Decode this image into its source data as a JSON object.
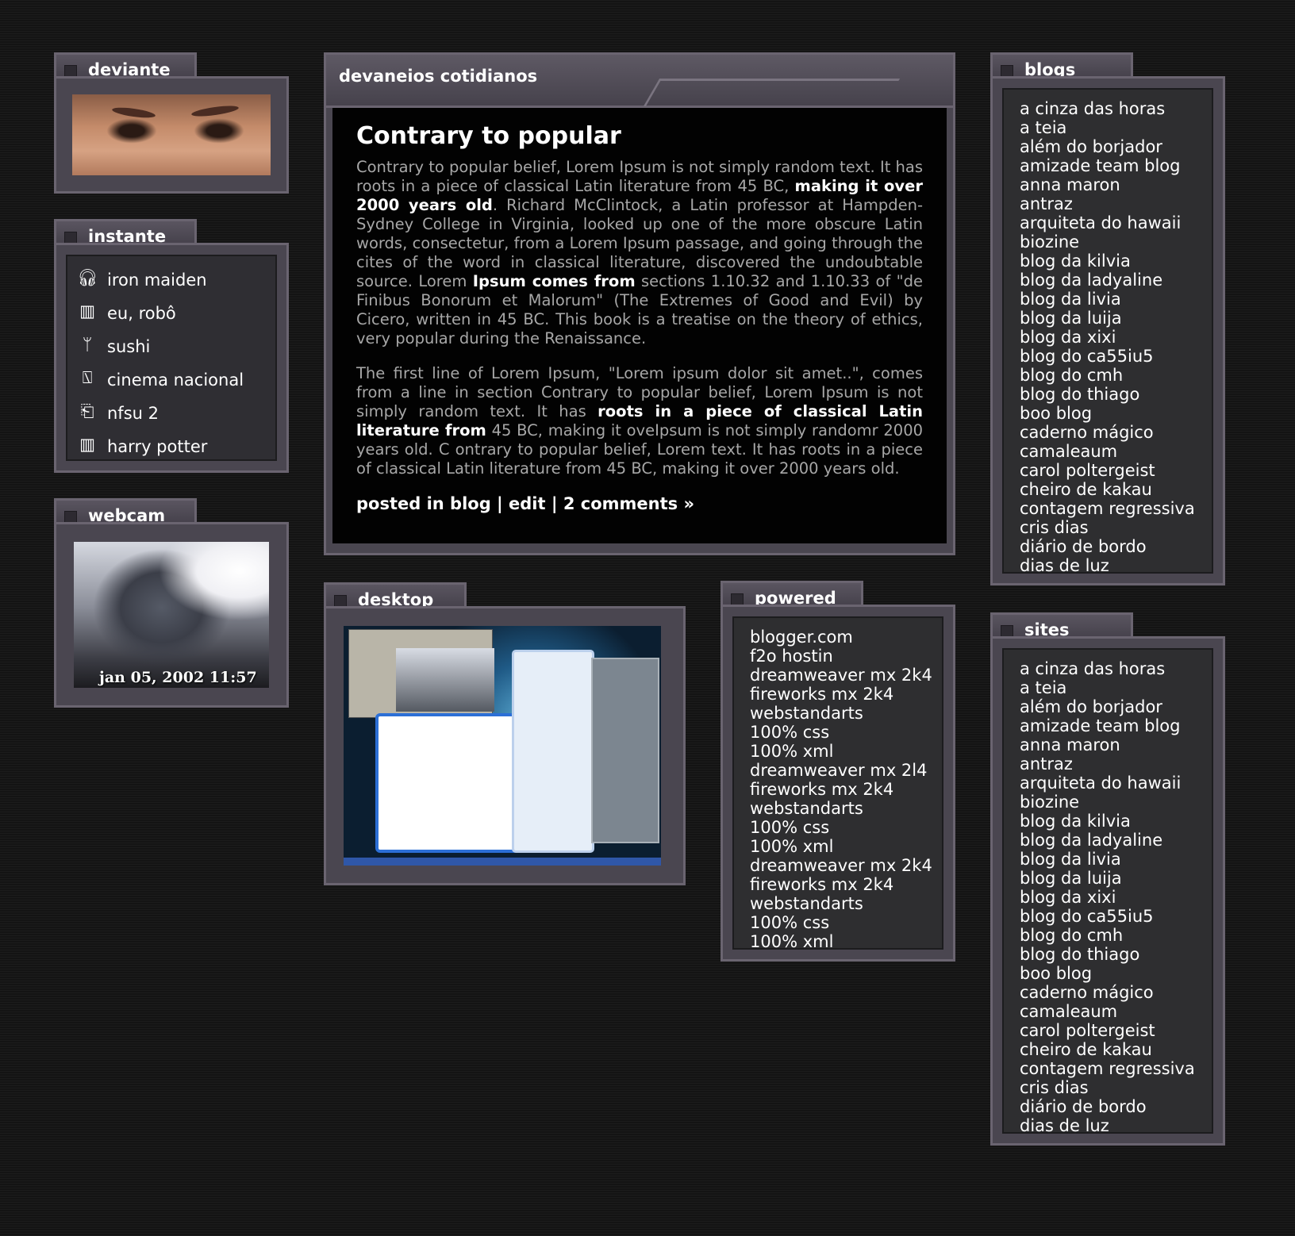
{
  "deviante": {
    "title": "deviante"
  },
  "instante": {
    "title": "instante",
    "items": [
      {
        "icon": "headphones-icon",
        "label": "iron maiden"
      },
      {
        "icon": "film-icon",
        "label": "eu, robô"
      },
      {
        "icon": "utensils-icon",
        "label": "sushi"
      },
      {
        "icon": "tv-icon",
        "label": "cinema nacional"
      },
      {
        "icon": "gamepad-icon",
        "label": "nfsu 2"
      },
      {
        "icon": "book-icon",
        "label": "harry potter"
      }
    ]
  },
  "webcam": {
    "title": "webcam",
    "timestamp": "jan 05, 2002 11:57"
  },
  "post": {
    "header": "devaneios cotidianos",
    "title": "Contrary to popular",
    "p1": {
      "a": "Contrary to popular belief, Lorem Ipsum is not simply random text. It has roots in a piece of classical Latin literature from 45 BC, ",
      "b": "making it over 2000 years old",
      "c": ". Richard McClintock, a Latin professor at Hampden-Sydney College in Virginia, looked up one of the more obscure Latin words, consectetur, from a Lorem Ipsum passage, and going through the cites of the word in classical literature, discovered the undoubtable source. Lorem ",
      "d": "Ipsum comes from",
      "e": " sections 1.10.32 and 1.10.33 of \"de Finibus Bonorum et Malorum\" (The Extremes of Good and Evil) by Cicero, written in 45 BC. This book is a treatise on the theory of ethics, very popular during the Renaissance."
    },
    "p2": {
      "a": "The first line of Lorem Ipsum, \"Lorem ipsum dolor sit amet..\", comes from a line in section Contrary to popular belief, Lorem Ipsum is not simply random text. It has ",
      "b": "roots in a piece of classical Latin literature from",
      "c": " 45 BC, making it oveIpsum is not simply randomr 2000 years old. C ontrary to popular belief, Lorem text. It has roots in a piece of classical Latin literature from 45 BC, making it over 2000 years old."
    },
    "meta": {
      "posted": "posted in blog",
      "sep1": " | ",
      "edit": "edit",
      "sep2": " | ",
      "comments": "2 comments »"
    }
  },
  "desktop": {
    "title": "desktop"
  },
  "powered": {
    "title": "powered",
    "items": [
      "blogger.com",
      "f2o hostin",
      "dreamweaver mx 2k4",
      "fireworks mx 2k4",
      "webstandarts",
      "100% css",
      "100% xml",
      "dreamweaver mx 2l4",
      "fireworks mx 2k4",
      "webstandarts",
      "100% css",
      "100% xml",
      "dreamweaver mx 2k4",
      "fireworks mx 2k4",
      "webstandarts",
      "100% css",
      "100% xml"
    ]
  },
  "blogs": {
    "title": "blogs",
    "items": [
      "a cinza das horas",
      "a teia",
      "além do borjador",
      "amizade team blog",
      "anna maron",
      "antraz",
      "arquiteta do hawaii",
      "biozine",
      "blog da kilvia",
      "blog da ladyaline",
      "blog da livia",
      "blog da luija",
      "blog da xixi",
      "blog do ca55iu5",
      "blog do cmh",
      "blog do thiago",
      "boo blog",
      "caderno mágico",
      "camaleaum",
      "carol poltergeist",
      "cheiro de kakau",
      "contagem regressiva",
      "cris dias",
      "diário de bordo",
      "dias de luz"
    ]
  },
  "sites": {
    "title": "sites",
    "items": [
      "a cinza das horas",
      "a teia",
      "além do borjador",
      "amizade team blog",
      "anna maron",
      "antraz",
      "arquiteta do hawaii",
      "biozine",
      "blog da kilvia",
      "blog da ladyaline",
      "blog da livia",
      "blog da luija",
      "blog da xixi",
      "blog do ca55iu5",
      "blog do cmh",
      "blog do thiago",
      "boo blog",
      "caderno mágico",
      "camaleaum",
      "carol poltergeist",
      "cheiro de kakau",
      "contagem regressiva",
      "cris dias",
      "diário de bordo",
      "dias de luz"
    ]
  }
}
